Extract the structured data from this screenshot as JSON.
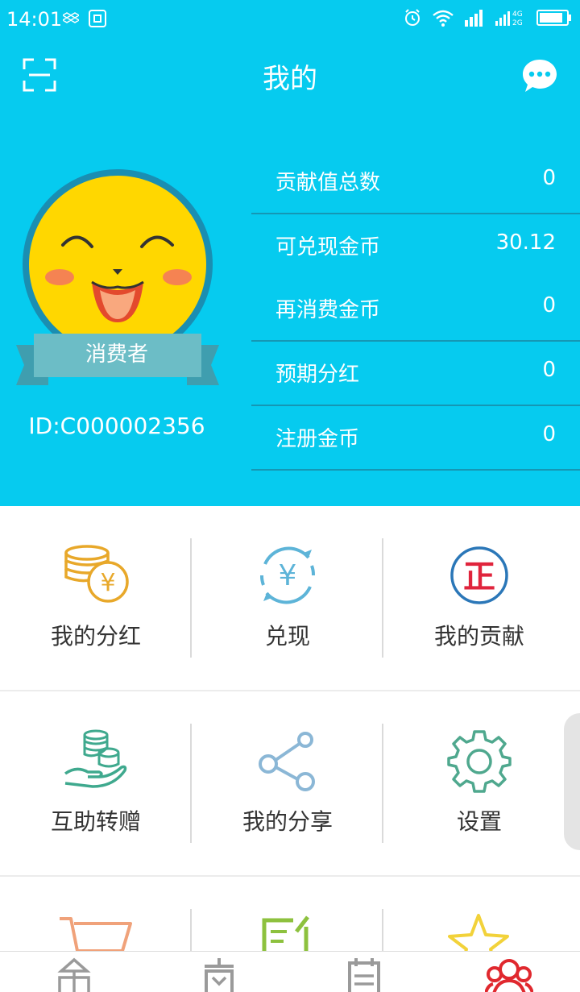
{
  "status_bar": {
    "time": "14:01",
    "icons": [
      "dropbox-icon",
      "screenshot-icon",
      "alarm-icon",
      "wifi-icon",
      "signal-icon",
      "signal-4g-2g-icon",
      "battery-icon"
    ],
    "network_labels": [
      "4G",
      "2G"
    ]
  },
  "nav": {
    "title": "我的",
    "left_icon": "scan-icon",
    "right_icon": "message-icon"
  },
  "profile": {
    "role": "消费者",
    "id": "ID:C000002356"
  },
  "stats": [
    {
      "label": "贡献值总数",
      "value": "0"
    },
    {
      "label": "可兑现金币",
      "value": "30.12"
    },
    {
      "label": "再消费金币",
      "value": "0"
    },
    {
      "label": "预期分红",
      "value": "0"
    },
    {
      "label": "注册金币",
      "value": "0"
    }
  ],
  "menu": [
    {
      "label": "我的分红",
      "icon": "coins-yen-icon"
    },
    {
      "label": "兑现",
      "icon": "yen-exchange-icon"
    },
    {
      "label": "我的贡献",
      "icon": "zheng-badge-icon"
    },
    {
      "label": "互助转赠",
      "icon": "hand-coins-icon"
    },
    {
      "label": "我的分享",
      "icon": "share-icon"
    },
    {
      "label": "设置",
      "icon": "gear-icon"
    }
  ],
  "menu_partial_icons": [
    "cart-icon",
    "edit-note-icon",
    "star-icon"
  ],
  "icon_glyphs": {
    "yen": "¥",
    "zheng": "正"
  },
  "tabbar": [
    "home-icon",
    "shop-icon",
    "list-icon",
    "user-group-icon"
  ],
  "colors": {
    "header_bg": "#06CBEF",
    "active_tab": "#E0282E",
    "inactive_tab": "#9A9A9A"
  }
}
